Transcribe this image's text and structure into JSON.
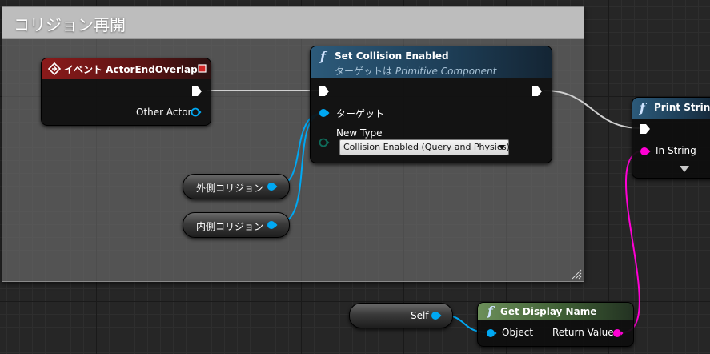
{
  "comment_box": {
    "title": "コリジョン再開"
  },
  "event_node": {
    "title": "イベント ActorEndOverlap",
    "pin_other_actor": "Other Actor"
  },
  "set_collision_node": {
    "title": "Set Collision Enabled",
    "subtitle_prefix": "ターゲットは",
    "subtitle_class": "Primitive Component",
    "pin_target": "ターゲット",
    "pin_new_type": "New Type",
    "new_type_value": "Collision Enabled (Query and Physics)"
  },
  "print_string_node": {
    "title": "Print String",
    "pin_in_string": "In String"
  },
  "get_display_name_node": {
    "title": "Get Display Name",
    "pin_object": "Object",
    "pin_return": "Return Value"
  },
  "var_nodes": {
    "outer": "外側コリジョン",
    "inner": "内側コリジョン",
    "self": "Self"
  },
  "colors": {
    "exec": "#ffffff",
    "object_pin": "#00a8f3",
    "string_pin": "#ff00d4",
    "event_header": "#8b1a1a",
    "function_header": "#2c5a7a",
    "pure_header": "#6c8f5a"
  },
  "icons": {
    "event": "diamond-arrow-icon",
    "function": "function-icon",
    "expand": "chevron-down-icon"
  }
}
